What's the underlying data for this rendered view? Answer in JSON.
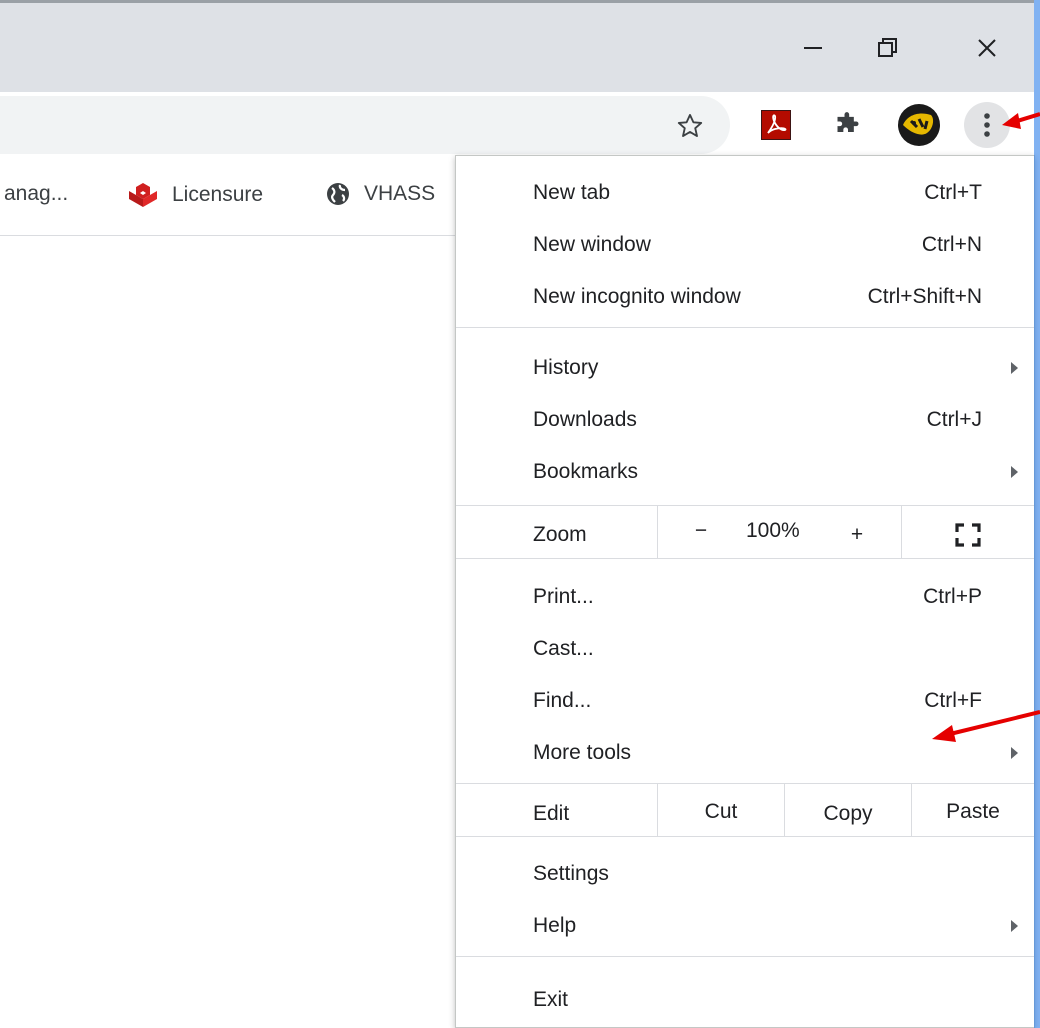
{
  "window": {
    "minimize_icon": "minimize-icon",
    "restore_icon": "restore-icon",
    "close_icon": "close-icon"
  },
  "toolbar": {
    "star_icon": "star-icon",
    "extensions": [
      "adobe-acrobat-icon",
      "puzzle-extensions-icon"
    ],
    "profile_icon": "profile-avatar",
    "menu_icon": "three-dots-menu-icon"
  },
  "bookmarks": {
    "items": [
      {
        "label": "anag..."
      },
      {
        "label": "Licensure"
      },
      {
        "label": "VHASS"
      }
    ]
  },
  "menu": {
    "new_tab": {
      "label": "New tab",
      "shortcut": "Ctrl+T"
    },
    "new_window": {
      "label": "New window",
      "shortcut": "Ctrl+N"
    },
    "new_incognito": {
      "label": "New incognito window",
      "shortcut": "Ctrl+Shift+N"
    },
    "history": {
      "label": "History"
    },
    "downloads": {
      "label": "Downloads",
      "shortcut": "Ctrl+J"
    },
    "bookmarks": {
      "label": "Bookmarks"
    },
    "zoom": {
      "label": "Zoom",
      "minus": "−",
      "level": "100%",
      "plus": "+"
    },
    "print": {
      "label": "Print...",
      "shortcut": "Ctrl+P"
    },
    "cast": {
      "label": "Cast..."
    },
    "find": {
      "label": "Find...",
      "shortcut": "Ctrl+F"
    },
    "more_tools": {
      "label": "More tools"
    },
    "edit": {
      "label": "Edit",
      "cut": "Cut",
      "copy": "Copy",
      "paste": "Paste"
    },
    "settings": {
      "label": "Settings"
    },
    "help": {
      "label": "Help"
    },
    "exit": {
      "label": "Exit"
    }
  },
  "colors": {
    "annotation_arrow": "#e50000",
    "titlebar": "#dee1e6",
    "omnibox": "#f1f3f4"
  }
}
